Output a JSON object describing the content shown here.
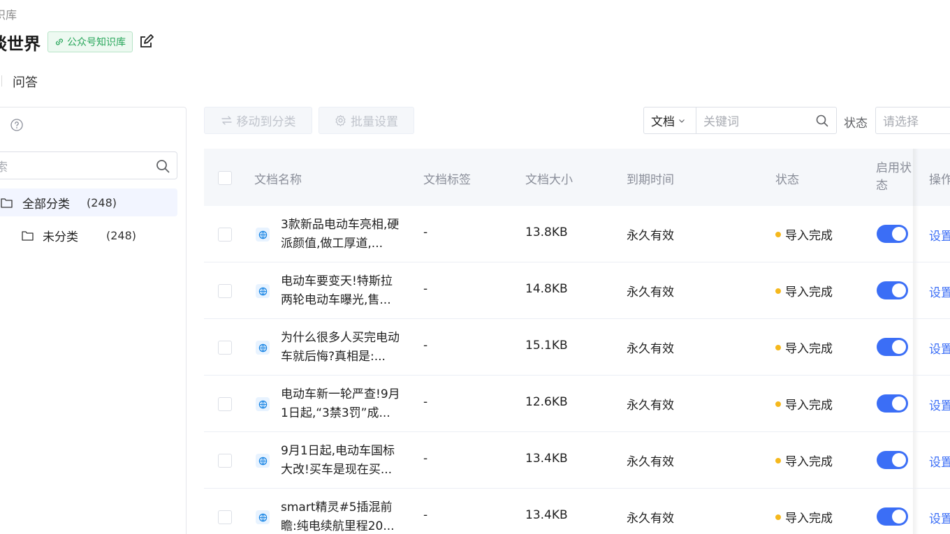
{
  "breadcrumb": "识库",
  "title": "谈世界",
  "badge": "公众号知识库",
  "tabs": {
    "qa": "问答"
  },
  "sidebar": {
    "search_placeholder": "索",
    "tree": [
      {
        "label": "全部分类",
        "count": "(248)"
      },
      {
        "label": "未分类",
        "count": "(248)"
      }
    ]
  },
  "toolbar": {
    "move_label": "移动到分类",
    "batch_label": "批量设置",
    "filter_type": "文档",
    "keyword_placeholder": "关键词",
    "status_label": "状态",
    "status_placeholder": "请选择"
  },
  "table": {
    "columns": {
      "name": "文档名称",
      "tag": "文档标签",
      "size": "文档大小",
      "expire": "到期时间",
      "status": "状态",
      "enable": "启用状态",
      "ops": "操作"
    },
    "rows": [
      {
        "name": "3款新品电动车亮相,硬派颜值,做工厚道,...",
        "tag": "-",
        "size": "13.8KB",
        "expire": "永久有效",
        "status": "导入完成",
        "enabled": true,
        "op": "设置"
      },
      {
        "name": "电动车要变天!特斯拉两轮电动车曝光,售...",
        "tag": "-",
        "size": "14.8KB",
        "expire": "永久有效",
        "status": "导入完成",
        "enabled": true,
        "op": "设置"
      },
      {
        "name": "为什么很多人买完电动车就后悔?真相是:...",
        "tag": "-",
        "size": "15.1KB",
        "expire": "永久有效",
        "status": "导入完成",
        "enabled": true,
        "op": "设置"
      },
      {
        "name": "电动车新一轮严查!9月1日起,“3禁3罚”成...",
        "tag": "-",
        "size": "12.6KB",
        "expire": "永久有效",
        "status": "导入完成",
        "enabled": true,
        "op": "设置"
      },
      {
        "name": "9月1日起,电动车国标大改!买车是现在买...",
        "tag": "-",
        "size": "13.4KB",
        "expire": "永久有效",
        "status": "导入完成",
        "enabled": true,
        "op": "设置"
      },
      {
        "name": "smart精灵#5插混前瞻:纯电续航里程20...",
        "tag": "-",
        "size": "13.4KB",
        "expire": "永久有效",
        "status": "导入完成",
        "enabled": true,
        "op": "设置"
      }
    ]
  },
  "colors": {
    "accent": "#3b6ef6",
    "badge_green": "#27a65a",
    "status_dot": "#f5b81d"
  }
}
